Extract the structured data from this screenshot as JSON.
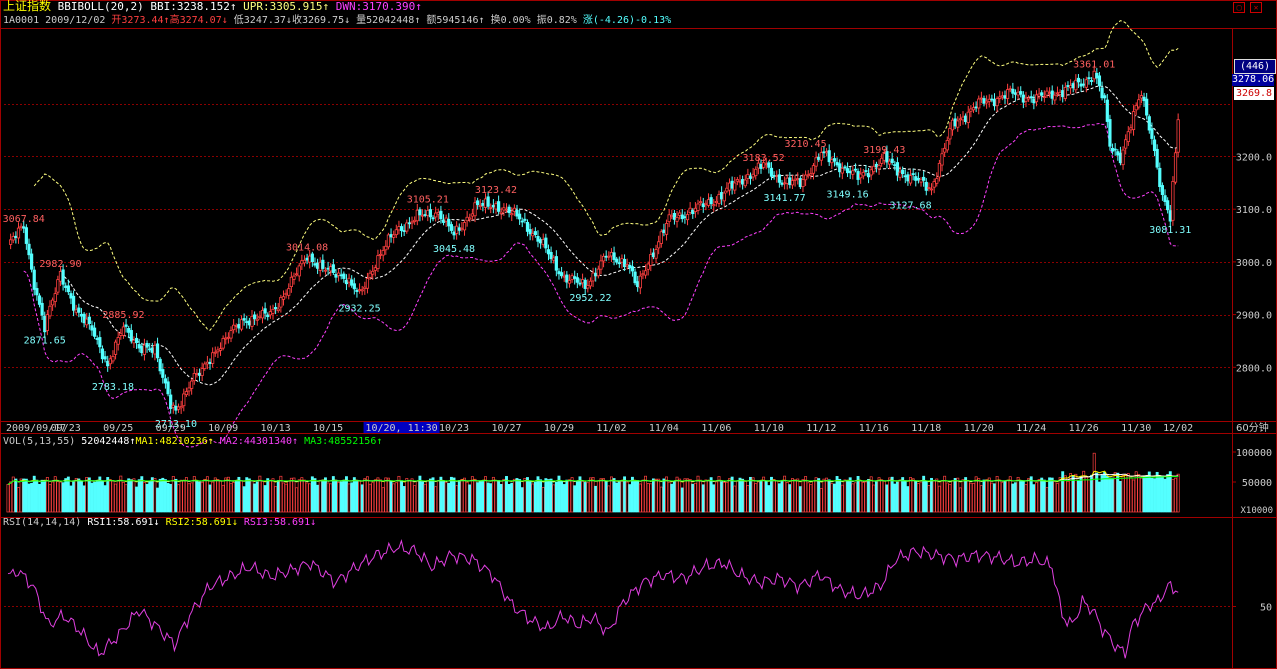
{
  "header": {
    "index_name": "上证指数",
    "indicator": "BBIBOLL(20,2)",
    "bbi": "BBI:3238.152↑",
    "upr": "UPR:3305.915↑",
    "dwn": "DWN:3170.390↑",
    "code": "1A0001",
    "date": "2009/12/02",
    "open": "开3273.44↑",
    "high": "高3274.07↓",
    "low": "低3247.37↓",
    "close": "收3269.75↓",
    "volume": "量52042448↑",
    "amount": "额5945146↑",
    "turnover": "换0.00%",
    "amplitude": "振0.82%",
    "change": "涨(-4.26)-0.13%"
  },
  "right_panel": {
    "badge": "(446)",
    "highlight_price": "3278.06",
    "last_price": "3269.8",
    "period_label": "60分钟",
    "vol_unit": "X10000",
    "price_ticks": [
      "3200.0",
      "3100.0",
      "3000.0",
      "2900.0",
      "2800.0"
    ],
    "vol_ticks": [
      "100000",
      "50000"
    ],
    "rsi_ticks": [
      "50"
    ]
  },
  "vol_header": {
    "name": "VOL(5,13,55)",
    "value": "52042448↑",
    "ma1": "MA1:48210236↑",
    "ma2": "MA2:44301340↑",
    "ma3": "MA3:48552156↑"
  },
  "rsi_header": {
    "name": "RSI(14,14,14)",
    "rsi1": "RSI1:58.691↓",
    "rsi2": "RSI2:58.691↓",
    "rsi3": "RSI3:58.691↓"
  },
  "colors": {
    "up": "#ff4040",
    "down": "#54ffff",
    "upr": "#ffff80",
    "dwn": "#ff40ff",
    "bbi": "#ffffff",
    "grid": "#8b0000",
    "frame": "#a00000",
    "ma1": "#ffffff",
    "ma2": "#ffff00",
    "ma3": "#00ff00",
    "rsi": "#e040e0"
  },
  "chart_data": {
    "type": "candlestick",
    "ylim": [
      2700,
      3440
    ],
    "x_tick_labels": [
      "2009/09/17",
      "09/23",
      "09/25",
      "09/29",
      "10/09",
      "10/13",
      "10/15",
      "10/19",
      "10/20, 11:30",
      "10/23",
      "10/27",
      "10/29",
      "11/02",
      "11/04",
      "11/06",
      "11/10",
      "11/12",
      "11/16",
      "11/18",
      "11/20",
      "11/24",
      "11/26",
      "11/30",
      "12/02"
    ],
    "highlighted_x_label": "10/20, 11:30",
    "x_tick_index": [
      0,
      22,
      42,
      62,
      82,
      102,
      122,
      144,
      150,
      170,
      190,
      210,
      230,
      250,
      270,
      290,
      310,
      330,
      350,
      370,
      390,
      410,
      430,
      446
    ],
    "anchors": [
      {
        "i": 0,
        "p": 3030
      },
      {
        "i": 6,
        "p": 3067.84
      },
      {
        "i": 10,
        "p": 2960
      },
      {
        "i": 14,
        "p": 2871.65
      },
      {
        "i": 20,
        "p": 2982.9
      },
      {
        "i": 26,
        "p": 2900
      },
      {
        "i": 32,
        "p": 2880
      },
      {
        "i": 38,
        "p": 2795
      },
      {
        "i": 44,
        "p": 2885.92
      },
      {
        "i": 50,
        "p": 2830
      },
      {
        "i": 56,
        "p": 2840
      },
      {
        "i": 62,
        "p": 2725
      },
      {
        "i": 64,
        "p": 2713.1
      },
      {
        "i": 70,
        "p": 2780
      },
      {
        "i": 74,
        "p": 2790
      },
      {
        "i": 80,
        "p": 2840
      },
      {
        "i": 90,
        "p": 2890
      },
      {
        "i": 100,
        "p": 2900
      },
      {
        "i": 108,
        "p": 2960
      },
      {
        "i": 114,
        "p": 3014.08
      },
      {
        "i": 120,
        "p": 2985
      },
      {
        "i": 128,
        "p": 2975
      },
      {
        "i": 134,
        "p": 2935
      },
      {
        "i": 140,
        "p": 3000
      },
      {
        "i": 148,
        "p": 3060
      },
      {
        "i": 156,
        "p": 3085
      },
      {
        "i": 164,
        "p": 3095
      },
      {
        "i": 170,
        "p": 3050
      },
      {
        "i": 178,
        "p": 3105
      },
      {
        "i": 186,
        "p": 3108
      },
      {
        "i": 196,
        "p": 3080
      },
      {
        "i": 204,
        "p": 3030
      },
      {
        "i": 212,
        "p": 2970
      },
      {
        "i": 220,
        "p": 2955
      },
      {
        "i": 228,
        "p": 3010
      },
      {
        "i": 236,
        "p": 3000
      },
      {
        "i": 240,
        "p": 2950
      },
      {
        "i": 244,
        "p": 3000
      },
      {
        "i": 252,
        "p": 3080
      },
      {
        "i": 262,
        "p": 3100
      },
      {
        "i": 270,
        "p": 3120
      },
      {
        "i": 278,
        "p": 3150
      },
      {
        "i": 288,
        "p": 3183.52
      },
      {
        "i": 296,
        "p": 3150
      },
      {
        "i": 302,
        "p": 3150
      },
      {
        "i": 310,
        "p": 3205
      },
      {
        "i": 318,
        "p": 3180
      },
      {
        "i": 324,
        "p": 3160
      },
      {
        "i": 334,
        "p": 3195
      },
      {
        "i": 342,
        "p": 3165
      },
      {
        "i": 352,
        "p": 3140
      },
      {
        "i": 360,
        "p": 3260
      },
      {
        "i": 370,
        "p": 3300
      },
      {
        "i": 382,
        "p": 3320
      },
      {
        "i": 392,
        "p": 3310
      },
      {
        "i": 402,
        "p": 3325
      },
      {
        "i": 410,
        "p": 3340
      },
      {
        "i": 414,
        "p": 3361.01
      },
      {
        "i": 418,
        "p": 3300
      },
      {
        "i": 420,
        "p": 3220
      },
      {
        "i": 424,
        "p": 3200
      },
      {
        "i": 428,
        "p": 3260
      },
      {
        "i": 432,
        "p": 3320
      },
      {
        "i": 436,
        "p": 3240
      },
      {
        "i": 440,
        "p": 3120
      },
      {
        "i": 443,
        "p": 3081.31
      },
      {
        "i": 446,
        "p": 3269.75
      }
    ],
    "annotations": [
      {
        "i": 6,
        "price": 3067.84,
        "label": "3067.84",
        "side": "high"
      },
      {
        "i": 14,
        "price": 2871.65,
        "label": "2871.65",
        "side": "low"
      },
      {
        "i": 20,
        "price": 2982.9,
        "label": "2982.90",
        "side": "high"
      },
      {
        "i": 44,
        "price": 2885.92,
        "label": "2885.92",
        "side": "high"
      },
      {
        "i": 40,
        "price": 2783.18,
        "label": "2783.18",
        "side": "low"
      },
      {
        "i": 64,
        "price": 2713.1,
        "label": "2713.10",
        "side": "low"
      },
      {
        "i": 114,
        "price": 3014.08,
        "label": "3014.08",
        "side": "high"
      },
      {
        "i": 134,
        "price": 2932.25,
        "label": "2932.25",
        "side": "low"
      },
      {
        "i": 160,
        "price": 3105.21,
        "label": "3105.21",
        "side": "high"
      },
      {
        "i": 170,
        "price": 3045.48,
        "label": "3045.48",
        "side": "low"
      },
      {
        "i": 186,
        "price": 3123.42,
        "label": "3123.42",
        "side": "high"
      },
      {
        "i": 222,
        "price": 2952.22,
        "label": "2952.22",
        "side": "low"
      },
      {
        "i": 288,
        "price": 3183.52,
        "label": "3183.52",
        "side": "high"
      },
      {
        "i": 296,
        "price": 3141.77,
        "label": "3141.77",
        "side": "low"
      },
      {
        "i": 304,
        "price": 3210.45,
        "label": "3210.45",
        "side": "high"
      },
      {
        "i": 320,
        "price": 3149.16,
        "label": "3149.16",
        "side": "low"
      },
      {
        "i": 334,
        "price": 3199.43,
        "label": "3199.43",
        "side": "high"
      },
      {
        "i": 344,
        "price": 3127.68,
        "label": "3127.68",
        "side": "low"
      },
      {
        "i": 414,
        "price": 3361.01,
        "label": "3361.01",
        "side": "high"
      },
      {
        "i": 443,
        "price": 3081.31,
        "label": "3081.31",
        "side": "low"
      }
    ],
    "rsi_anchors": [
      {
        "i": 0,
        "v": 65
      },
      {
        "i": 4,
        "v": 68
      },
      {
        "i": 10,
        "v": 60
      },
      {
        "i": 16,
        "v": 40
      },
      {
        "i": 22,
        "v": 45
      },
      {
        "i": 28,
        "v": 38
      },
      {
        "i": 36,
        "v": 25
      },
      {
        "i": 44,
        "v": 35
      },
      {
        "i": 52,
        "v": 48
      },
      {
        "i": 60,
        "v": 38
      },
      {
        "i": 66,
        "v": 30
      },
      {
        "i": 72,
        "v": 45
      },
      {
        "i": 80,
        "v": 60
      },
      {
        "i": 88,
        "v": 65
      },
      {
        "i": 96,
        "v": 70
      },
      {
        "i": 104,
        "v": 65
      },
      {
        "i": 112,
        "v": 68
      },
      {
        "i": 120,
        "v": 72
      },
      {
        "i": 130,
        "v": 62
      },
      {
        "i": 138,
        "v": 70
      },
      {
        "i": 146,
        "v": 76
      },
      {
        "i": 154,
        "v": 80
      },
      {
        "i": 162,
        "v": 78
      },
      {
        "i": 168,
        "v": 70
      },
      {
        "i": 176,
        "v": 76
      },
      {
        "i": 184,
        "v": 74
      },
      {
        "i": 192,
        "v": 66
      },
      {
        "i": 200,
        "v": 50
      },
      {
        "i": 208,
        "v": 42
      },
      {
        "i": 214,
        "v": 38
      },
      {
        "i": 220,
        "v": 45
      },
      {
        "i": 226,
        "v": 40
      },
      {
        "i": 232,
        "v": 44
      },
      {
        "i": 238,
        "v": 36
      },
      {
        "i": 244,
        "v": 52
      },
      {
        "i": 252,
        "v": 62
      },
      {
        "i": 260,
        "v": 66
      },
      {
        "i": 268,
        "v": 64
      },
      {
        "i": 276,
        "v": 70
      },
      {
        "i": 284,
        "v": 72
      },
      {
        "i": 290,
        "v": 66
      },
      {
        "i": 298,
        "v": 62
      },
      {
        "i": 306,
        "v": 64
      },
      {
        "i": 314,
        "v": 60
      },
      {
        "i": 322,
        "v": 66
      },
      {
        "i": 330,
        "v": 58
      },
      {
        "i": 338,
        "v": 55
      },
      {
        "i": 346,
        "v": 60
      },
      {
        "i": 352,
        "v": 74
      },
      {
        "i": 360,
        "v": 78
      },
      {
        "i": 368,
        "v": 76
      },
      {
        "i": 376,
        "v": 74
      },
      {
        "i": 384,
        "v": 76
      },
      {
        "i": 392,
        "v": 75
      },
      {
        "i": 400,
        "v": 72
      },
      {
        "i": 408,
        "v": 74
      },
      {
        "i": 414,
        "v": 70
      },
      {
        "i": 418,
        "v": 45
      },
      {
        "i": 422,
        "v": 40
      },
      {
        "i": 426,
        "v": 52
      },
      {
        "i": 430,
        "v": 48
      },
      {
        "i": 434,
        "v": 38
      },
      {
        "i": 440,
        "v": 28
      },
      {
        "i": 443,
        "v": 26
      },
      {
        "i": 446,
        "v": 40
      },
      {
        "i": 452,
        "v": 50
      },
      {
        "i": 456,
        "v": 52
      },
      {
        "i": 460,
        "v": 60
      },
      {
        "i": 464,
        "v": 58
      }
    ],
    "rsi_ylim": [
      20,
      90
    ],
    "vol_ylim": [
      0,
      110000
    ]
  }
}
